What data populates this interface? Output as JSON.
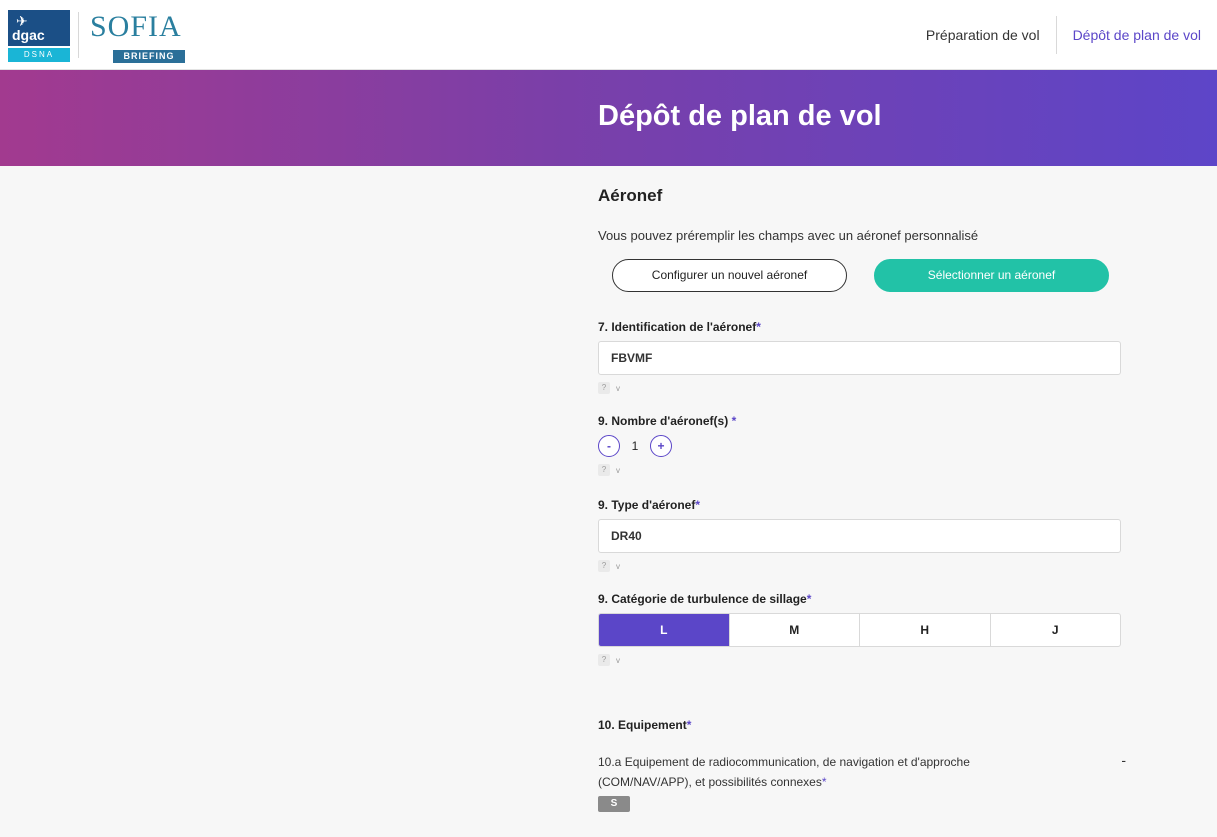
{
  "header": {
    "logo_dgac_text": "dgac",
    "logo_dsna_text": "DSNA",
    "logo_sofia_text": "SOFIA",
    "logo_briefing_text": "BRIEFING",
    "nav": [
      {
        "label": "Préparation de vol"
      },
      {
        "label": "Dépôt de plan de vol"
      }
    ]
  },
  "banner": {
    "title": "Dépôt de plan de vol"
  },
  "aircraft": {
    "section_title": "Aéronef",
    "hint": "Vous pouvez préremplir les champs avec un aéronef personnalisé",
    "configure_button": "Configurer un nouvel aéronef",
    "select_button": "Sélectionner un aéronef"
  },
  "fields": {
    "identification": {
      "label": "7. Identification de l'aéronef",
      "required": "*",
      "value": "FBVMF"
    },
    "count": {
      "label": "9. Nombre d'aéronef(s)",
      "required": "*",
      "value": "1",
      "minus": "-",
      "plus": "+"
    },
    "type": {
      "label": "9. Type d'aéronef",
      "required": "*",
      "value": "DR40"
    },
    "turbulence": {
      "label": "9. Catégorie de turbulence de sillage",
      "required": "*",
      "options": [
        "L",
        "M",
        "H",
        "J"
      ],
      "selected": "L"
    },
    "help_q": "?",
    "help_v": "v"
  },
  "equipment": {
    "label": "10. Equipement",
    "required": "*",
    "sub_label": "10.a Equipement de radiocommunication, de navigation et d'approche (COM/NAV/APP), et possibilités connexes",
    "sub_required": "*",
    "collapse": "-",
    "badge": "S"
  }
}
